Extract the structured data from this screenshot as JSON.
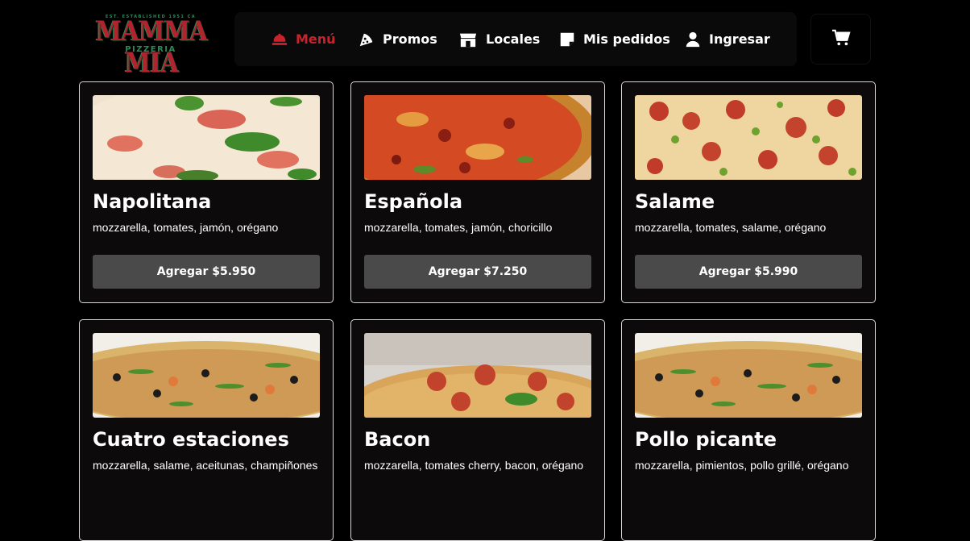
{
  "colors": {
    "background": "#000000",
    "accent": "#c8232d",
    "card_bg": "#0c0a0b",
    "button_bg": "#4a4a4b",
    "logo_red": "#b3232e",
    "logo_green": "#2c8a57"
  },
  "logo": {
    "top_text": "EST. ESTABLISHED 1951 CA",
    "main": "MAMMA MIA",
    "sub": "PIZZERIA"
  },
  "nav": {
    "items": [
      {
        "label": "Menú",
        "icon": "bell-icon",
        "active": true
      },
      {
        "label": "Promos",
        "icon": "pizza-slice-icon",
        "active": false
      },
      {
        "label": "Locales",
        "icon": "store-icon",
        "active": false
      },
      {
        "label": "Mis pedidos",
        "icon": "note-icon",
        "active": false
      },
      {
        "label": "Ingresar",
        "icon": "user-icon",
        "active": false
      }
    ]
  },
  "cart": {
    "icon": "cart-icon"
  },
  "products": [
    {
      "name": "Napolitana",
      "desc": "mozzarella, tomates, jamón, orégano",
      "button": "Agregar $5.950",
      "image": "pizza-napolitana-photo"
    },
    {
      "name": "Española",
      "desc": "mozzarella, tomates, jamón, choricillo",
      "button": "Agregar $7.250",
      "image": "pizza-espanola-photo"
    },
    {
      "name": "Salame",
      "desc": "mozzarella, tomates, salame, orégano",
      "button": "Agregar $5.990",
      "image": "pizza-salame-photo"
    },
    {
      "name": "Cuatro estaciones",
      "desc": "mozzarella, salame, aceitunas, champiñones",
      "button": "",
      "image": "pizza-cuatro-estaciones-photo"
    },
    {
      "name": "Bacon",
      "desc": "mozzarella, tomates cherry, bacon, orégano",
      "button": "",
      "image": "pizza-bacon-photo"
    },
    {
      "name": "Pollo picante",
      "desc": "mozzarella, pimientos, pollo grillé, orégano",
      "button": "",
      "image": "pizza-pollo-picante-photo"
    }
  ]
}
